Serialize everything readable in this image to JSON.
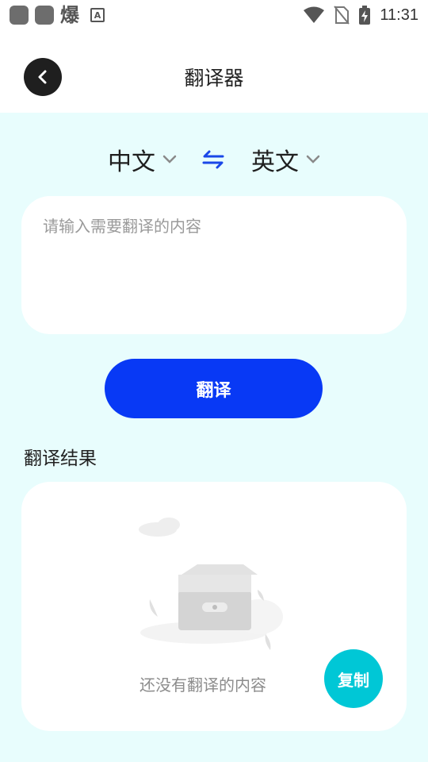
{
  "status_bar": {
    "time": "11:31",
    "notif_glyph": "爆",
    "notif_a": "A",
    "icons": [
      "app-icon",
      "app-icon",
      "wifi-icon",
      "no-sim-icon",
      "battery-charging-icon"
    ]
  },
  "header": {
    "title": "翻译器",
    "back_icon": "chevron-left-icon"
  },
  "languages": {
    "source": "中文",
    "target": "英文",
    "swap_icon": "swap-arrows-icon"
  },
  "input": {
    "placeholder": "请输入需要翻译的内容",
    "value": ""
  },
  "actions": {
    "translate_label": "翻译",
    "copy_label": "复制"
  },
  "result": {
    "heading": "翻译结果",
    "empty_text": "还没有翻译的内容",
    "empty_icon": "empty-box-icon"
  },
  "colors": {
    "background": "#e8fdfd",
    "primary": "#0839f5",
    "copy": "#00c7d6",
    "swap": "#1a47e8"
  }
}
